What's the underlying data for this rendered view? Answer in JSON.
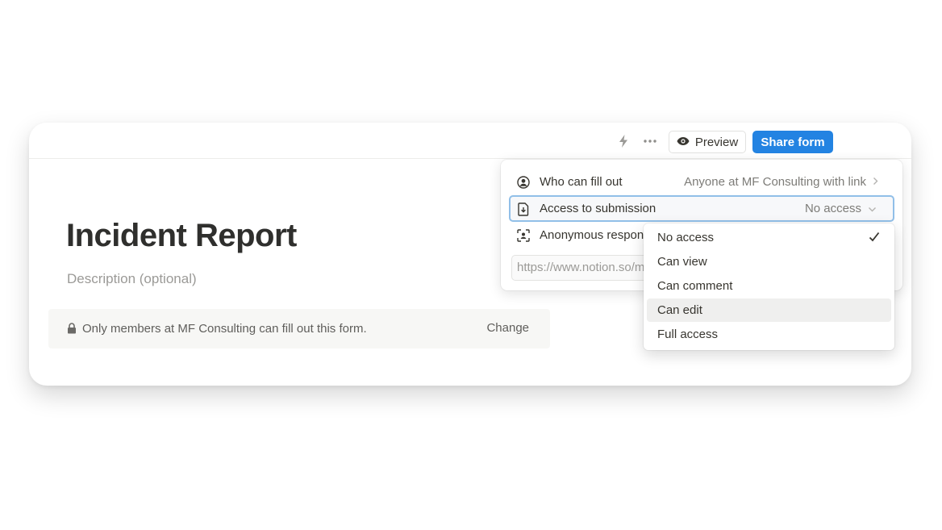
{
  "toolbar": {
    "preview_label": "Preview",
    "share_label": "Share form",
    "icons": [
      "bolt-icon",
      "more-icon",
      "eye-icon"
    ]
  },
  "page": {
    "title": "Incident Report",
    "description_placeholder": "Description (optional)",
    "notice_text": "Only members at MF Consulting can fill out this form.",
    "change_label": "Change"
  },
  "share_panel": {
    "who_label": "Who can fill out",
    "who_value": "Anyone at MF Consulting with link",
    "access_label": "Access to submission",
    "access_value": "No access",
    "anonymous_label": "Anonymous respon",
    "link_value": "https://www.notion.so/m"
  },
  "access_dropdown": {
    "selected": "No access",
    "highlighted": "Can edit",
    "options": [
      "No access",
      "Can view",
      "Can comment",
      "Can edit",
      "Full access"
    ]
  },
  "colors": {
    "accent": "#2383e2",
    "focus_border": "#91bfe8"
  }
}
